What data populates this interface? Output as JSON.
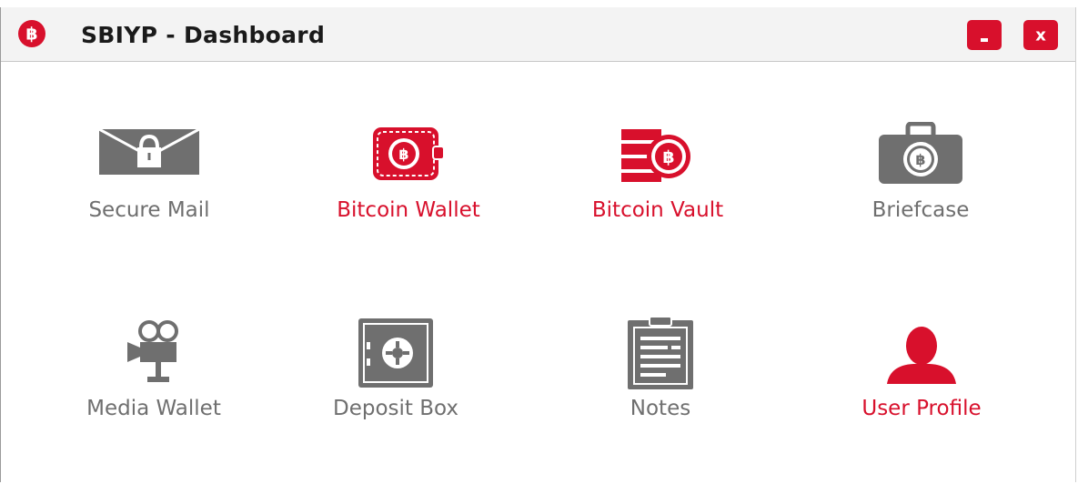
{
  "window": {
    "title": "SBIYP - Dashboard",
    "minimize_label": "-",
    "close_label": "x"
  },
  "colors": {
    "accent": "#d8102c",
    "icon_gray": "#6f6f6f",
    "titlebar_bg": "#f3f3f3"
  },
  "tiles": [
    {
      "label": "Secure Mail",
      "icon": "lock-envelope-icon",
      "color": "gray"
    },
    {
      "label": "Bitcoin Wallet",
      "icon": "bitcoin-wallet-icon",
      "color": "red"
    },
    {
      "label": "Bitcoin Vault",
      "icon": "bitcoin-vault-icon",
      "color": "red"
    },
    {
      "label": "Briefcase",
      "icon": "bitcoin-briefcase-icon",
      "color": "gray"
    },
    {
      "label": "Media Wallet",
      "icon": "video-camera-icon",
      "color": "gray"
    },
    {
      "label": "Deposit Box",
      "icon": "safe-icon",
      "color": "gray"
    },
    {
      "label": "Notes",
      "icon": "clipboard-notes-icon",
      "color": "gray"
    },
    {
      "label": "User Profile",
      "icon": "user-icon",
      "color": "red"
    }
  ]
}
